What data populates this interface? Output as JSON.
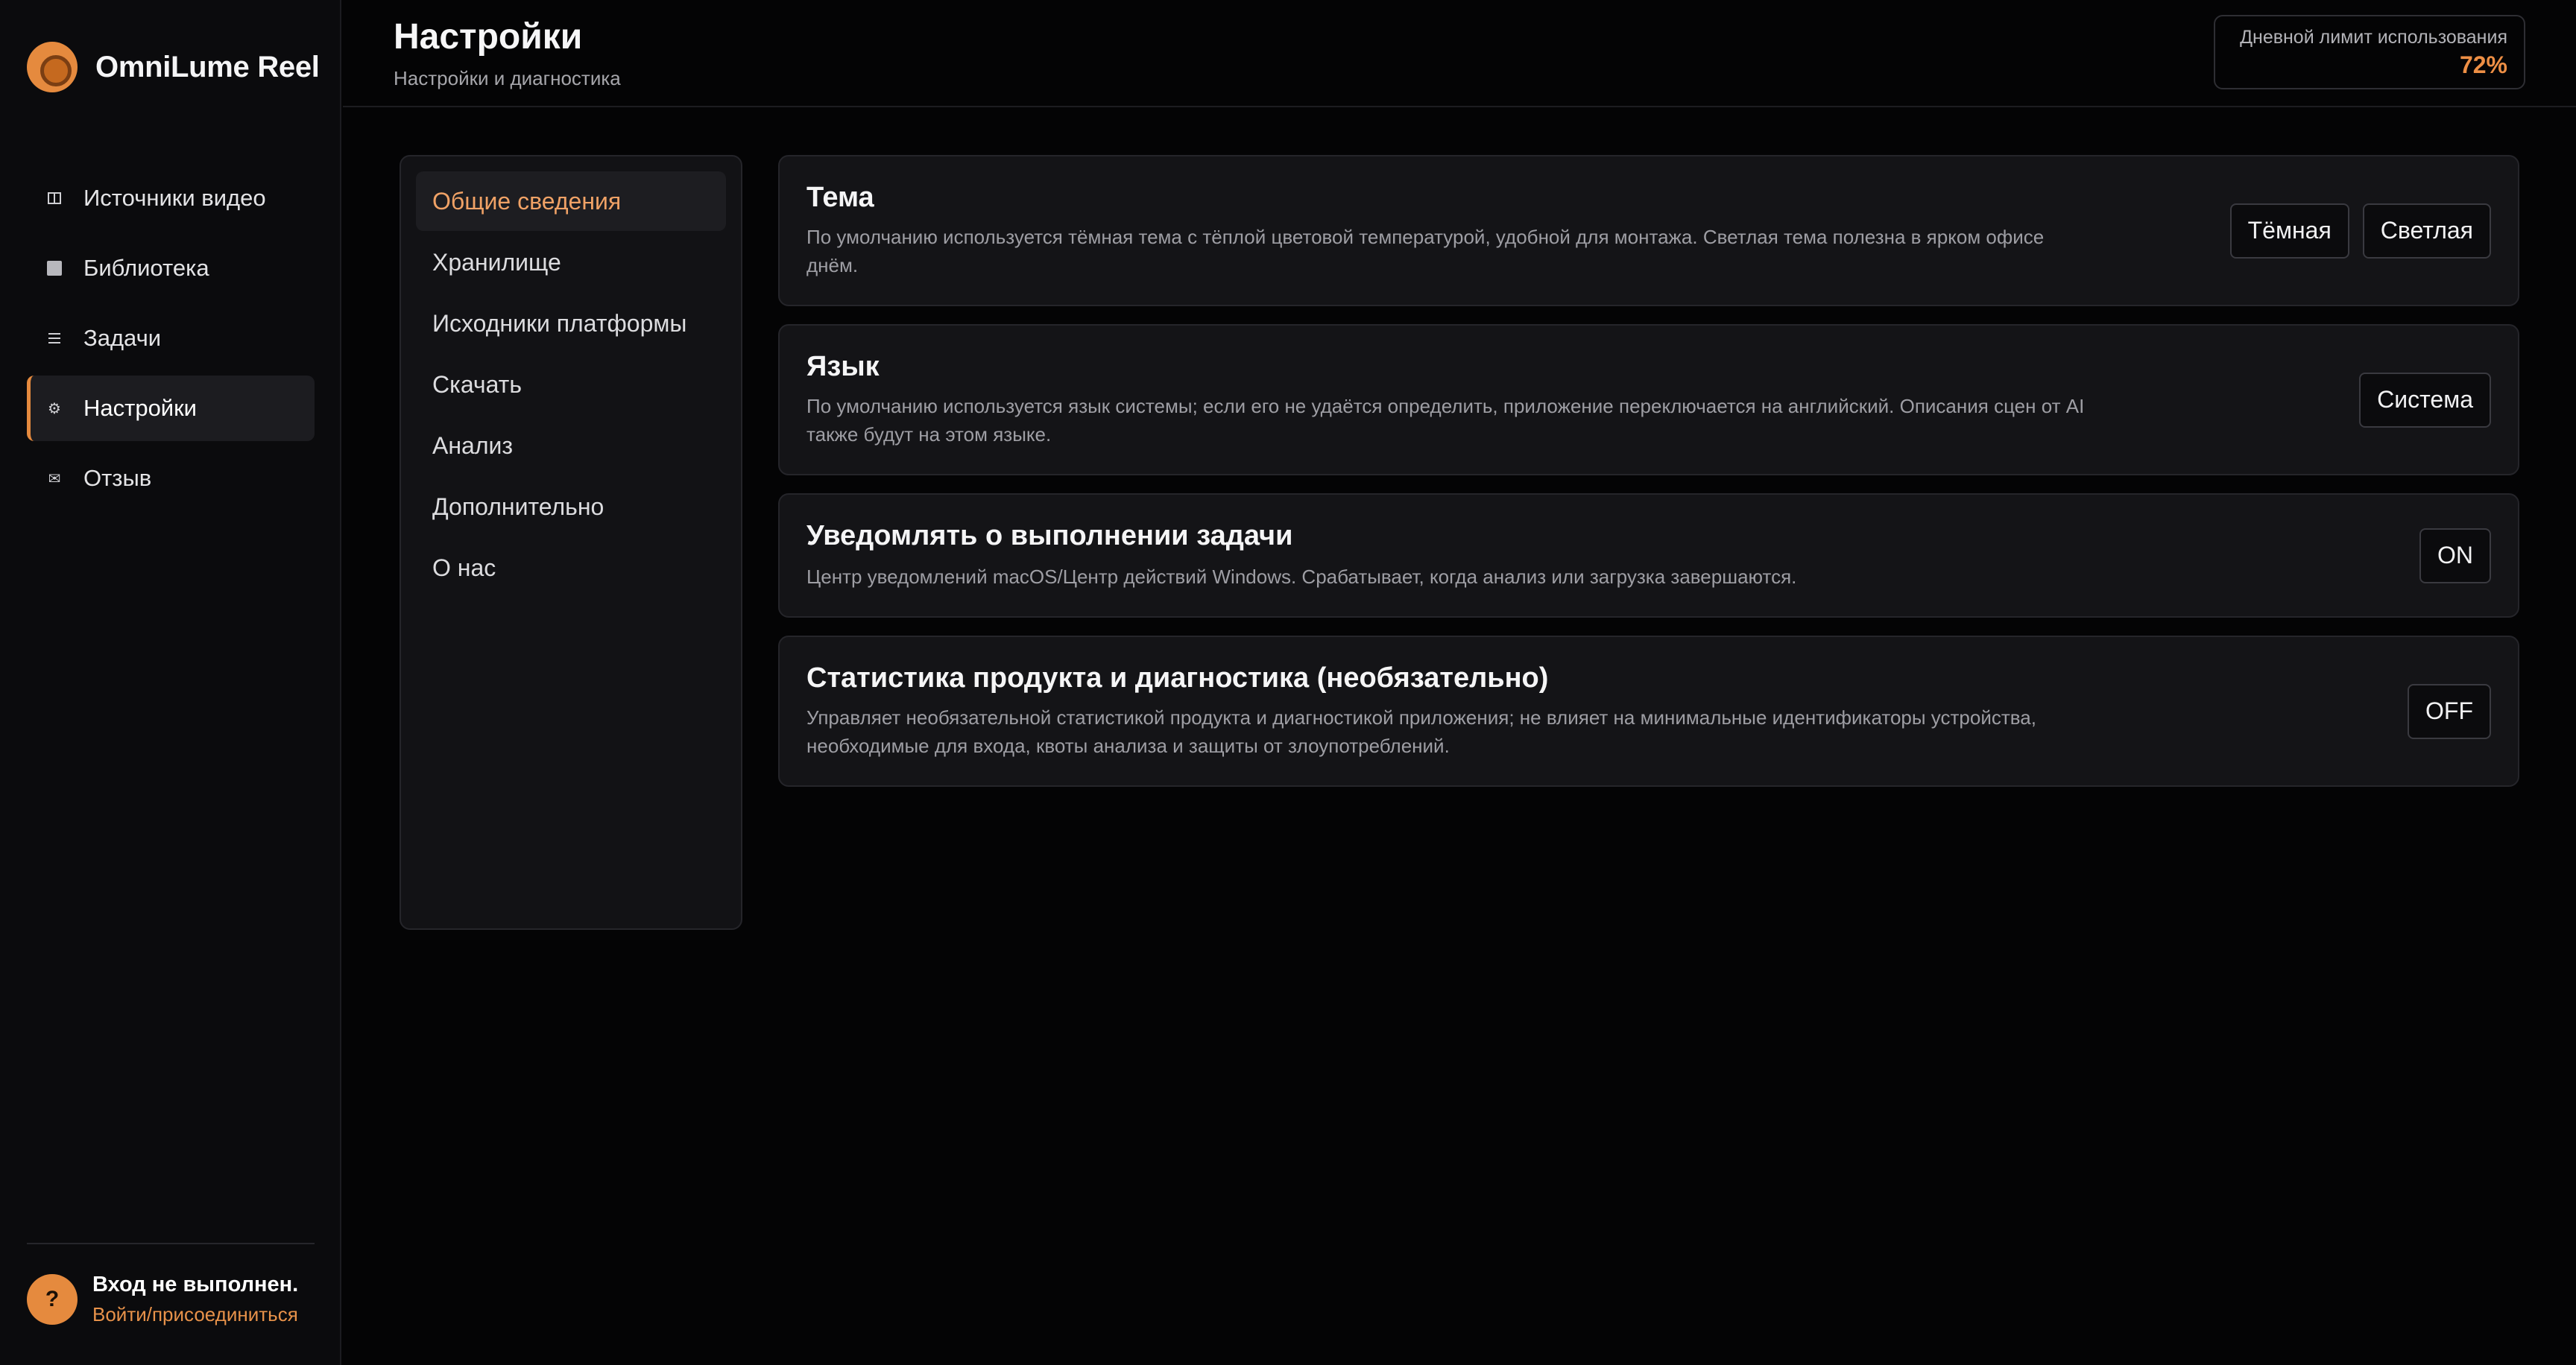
{
  "app": {
    "name": "OmniLume Reel"
  },
  "sidebar": {
    "items": [
      {
        "label": "Источники видео",
        "icon": "split-panel-icon",
        "active": false
      },
      {
        "label": "Библиотека",
        "icon": "library-square-icon",
        "active": false
      },
      {
        "label": "Задачи",
        "icon": "list-icon",
        "active": false
      },
      {
        "label": "Настройки",
        "icon": "gear-icon",
        "active": true
      },
      {
        "label": "Отзыв",
        "icon": "mail-icon",
        "active": false
      }
    ],
    "account": {
      "status": "Вход не выполнен.",
      "link": "Войти/присоединиться",
      "avatar_glyph": "?"
    }
  },
  "header": {
    "title": "Настройки",
    "subtitle": "Настройки и диагностика",
    "usage": {
      "label": "Дневной лимит использования",
      "value": "72%"
    }
  },
  "settings_menu": {
    "items": [
      {
        "label": "Общие сведения",
        "active": true
      },
      {
        "label": "Хранилище",
        "active": false
      },
      {
        "label": "Исходники платформы",
        "active": false
      },
      {
        "label": "Скачать",
        "active": false
      },
      {
        "label": "Анализ",
        "active": false
      },
      {
        "label": "Дополнительно",
        "active": false
      },
      {
        "label": "О нас",
        "active": false
      }
    ]
  },
  "cards": {
    "theme": {
      "title": "Тема",
      "description": "По умолчанию используется тёмная тема с тёплой цветовой температурой, удобной для монтажа. Светлая тема полезна в ярком офисе днём.",
      "dark_label": "Тёмная",
      "light_label": "Светлая"
    },
    "language": {
      "title": "Язык",
      "description": "По умолчанию используется язык системы; если его не удаётся определить, приложение переключается на английский. Описания сцен от AI также будут на этом языке.",
      "value": "Система"
    },
    "notify": {
      "title": "Уведомлять о выполнении задачи",
      "description": "Центр уведомлений macOS/Центр действий Windows. Срабатывает, когда анализ или загрузка завершаются.",
      "toggle": "ON"
    },
    "stats": {
      "title": "Статистика продукта и диагностика (необязательно)",
      "description": "Управляет необязательной статистикой продукта и диагностикой приложения; не влияет на минимальные идентификаторы устройства, необходимые для входа, квоты анализа и защиты от злоупотреблений.",
      "toggle": "OFF"
    }
  },
  "colors": {
    "accent": "#e58a3e",
    "background": "#040405",
    "sidebar": "#0b0b0d",
    "card": "#141417"
  }
}
